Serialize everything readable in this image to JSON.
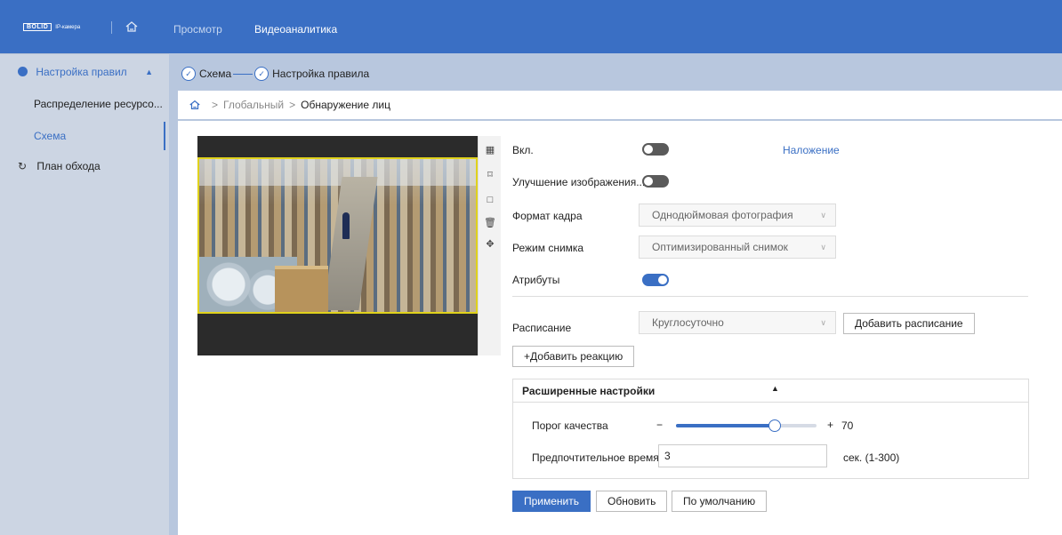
{
  "header": {
    "logo_mark": "BOLID",
    "logo_sub": "IP-камера",
    "nav": [
      {
        "label": "Просмотр"
      },
      {
        "label": "Видеоаналитика"
      }
    ]
  },
  "sidebar": {
    "group_label": "Настройка правил",
    "items": [
      {
        "label": "Распределение ресурсо..."
      },
      {
        "label": "Схема"
      }
    ],
    "patrol_label": "План обхода"
  },
  "steps": [
    {
      "label": "Схема"
    },
    {
      "label": "Настройка правила"
    }
  ],
  "breadcrumb": {
    "sep": ">",
    "items": [
      "Глобальный",
      "Обнаружение лиц"
    ]
  },
  "form": {
    "enable_label": "Вкл.",
    "enable_on": false,
    "overlay_link": "Наложение",
    "enhance_label": "Улучшение изображения...",
    "enhance_on": false,
    "frame_format_label": "Формат кадра",
    "frame_format_value": "Однодюймовая фотография",
    "snap_mode_label": "Режим снимка",
    "snap_mode_value": "Оптимизированный снимок",
    "attributes_label": "Атрибуты",
    "attributes_on": true,
    "schedule_label": "Расписание",
    "schedule_value": "Круглосуточно",
    "add_schedule_button": "Добавить расписание",
    "add_reaction_button": "+Добавить реакцию"
  },
  "advanced": {
    "title": "Расширенные настройки",
    "quality_label": "Порог качества",
    "minus": "−",
    "plus": "+",
    "quality_value": "70",
    "quality_fraction": 0.7,
    "pref_time_label": "Предпочтительное время",
    "pref_time_value": "3",
    "pref_time_unit": "сек. (1-300)"
  },
  "actions": {
    "apply": "Применить",
    "refresh": "Обновить",
    "default": "По умолчанию"
  },
  "colors": {
    "accent": "#3a6fc4",
    "sidebar_bg": "#ccd5e3",
    "main_bg": "#b8c7de"
  }
}
